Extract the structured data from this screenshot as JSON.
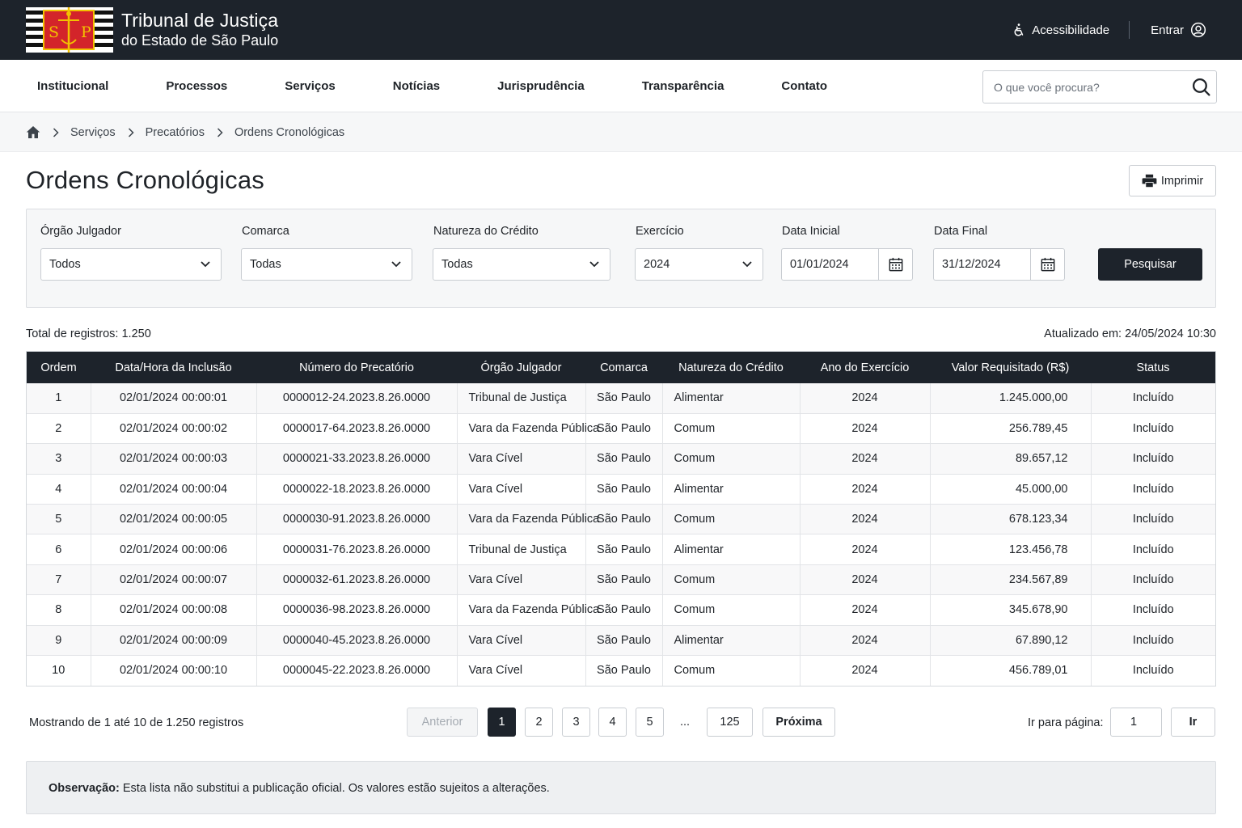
{
  "header": {
    "title": "Tribunal de Justiça",
    "subtitle": "do Estado de São Paulo",
    "logo_letters": "S P",
    "accessibility_label": "Acessibilidade",
    "login_label": "Entrar"
  },
  "nav": {
    "items": [
      {
        "label": "Institucional"
      },
      {
        "label": "Processos"
      },
      {
        "label": "Serviços"
      },
      {
        "label": "Notícias"
      },
      {
        "label": "Jurisprudência"
      },
      {
        "label": "Transparência"
      },
      {
        "label": "Contato"
      }
    ],
    "search_placeholder": "O que você procura?"
  },
  "breadcrumb": {
    "items": [
      {
        "label": "Serviços"
      },
      {
        "label": "Precatórios"
      },
      {
        "label": "Ordens Cronológicas"
      }
    ]
  },
  "page": {
    "title": "Ordens Cronológicas",
    "print_label": "Imprimir"
  },
  "filters": {
    "orgao": {
      "label": "Órgão Julgador",
      "value": "Todos"
    },
    "comarca": {
      "label": "Comarca",
      "value": "Todas"
    },
    "natureza": {
      "label": "Natureza do Crédito",
      "value": "Todas"
    },
    "exercicio": {
      "label": "Exercício",
      "value": "2024"
    },
    "data_inicial": {
      "label": "Data Inicial",
      "value": "01/01/2024"
    },
    "data_final": {
      "label": "Data Final",
      "value": "31/12/2024"
    },
    "submit_label": "Pesquisar"
  },
  "summary": {
    "total": "Total de registros: 1.250",
    "updated": "Atualizado em: 24/05/2024 10:30"
  },
  "table": {
    "columns": [
      "Ordem",
      "Data/Hora da Inclusão",
      "Número do Precatório",
      "Órgão Julgador",
      "Comarca",
      "Natureza do Crédito",
      "Ano do Exercício",
      "Valor Requisitado (R$)",
      "Status"
    ],
    "rows": [
      [
        "1",
        "02/01/2024 00:00:01",
        "0000012-24.2023.8.26.0000",
        "Tribunal de Justiça",
        "São Paulo",
        "Alimentar",
        "2024",
        "1.245.000,00",
        "Incluído"
      ],
      [
        "2",
        "02/01/2024 00:00:02",
        "0000017-64.2023.8.26.0000",
        "Vara da Fazenda Pública",
        "São Paulo",
        "Comum",
        "2024",
        "256.789,45",
        "Incluído"
      ],
      [
        "3",
        "02/01/2024 00:00:03",
        "0000021-33.2023.8.26.0000",
        "Vara Cível",
        "São Paulo",
        "Comum",
        "2024",
        "89.657,12",
        "Incluído"
      ],
      [
        "4",
        "02/01/2024 00:00:04",
        "0000022-18.2023.8.26.0000",
        "Vara Cível",
        "São Paulo",
        "Alimentar",
        "2024",
        "45.000,00",
        "Incluído"
      ],
      [
        "5",
        "02/01/2024 00:00:05",
        "0000030-91.2023.8.26.0000",
        "Vara da Fazenda Pública",
        "São Paulo",
        "Comum",
        "2024",
        "678.123,34",
        "Incluído"
      ],
      [
        "6",
        "02/01/2024 00:00:06",
        "0000031-76.2023.8.26.0000",
        "Tribunal de Justiça",
        "São Paulo",
        "Alimentar",
        "2024",
        "123.456,78",
        "Incluído"
      ],
      [
        "7",
        "02/01/2024 00:00:07",
        "0000032-61.2023.8.26.0000",
        "Vara Cível",
        "São Paulo",
        "Comum",
        "2024",
        "234.567,89",
        "Incluído"
      ],
      [
        "8",
        "02/01/2024 00:00:08",
        "0000036-98.2023.8.26.0000",
        "Vara da Fazenda Pública",
        "São Paulo",
        "Comum",
        "2024",
        "345.678,90",
        "Incluído"
      ],
      [
        "9",
        "02/01/2024 00:00:09",
        "0000040-45.2023.8.26.0000",
        "Vara Cível",
        "São Paulo",
        "Alimentar",
        "2024",
        "67.890,12",
        "Incluído"
      ],
      [
        "10",
        "02/01/2024 00:00:10",
        "0000045-22.2023.8.26.0000",
        "Vara Cível",
        "São Paulo",
        "Comum",
        "2024",
        "456.789,01",
        "Incluído"
      ]
    ]
  },
  "pagination": {
    "showing": "Mostrando de 1 até 10 de 1.250 registros",
    "prev_label": "Anterior",
    "pages": [
      "1",
      "2",
      "3",
      "4",
      "5"
    ],
    "current_page": "1",
    "ellipsis": "...",
    "last_page": "125",
    "next_label": "Próxima",
    "goto_label": "Ir para página:",
    "goto_value": "1",
    "goto_button": "Ir"
  },
  "note": {
    "label": "Observação:",
    "text": " Esta lista não substitui a publicação oficial. Os valores estão sujeitos a alterações."
  },
  "colors": {
    "header_bg": "#1d232b",
    "flag_red": "#d3242a",
    "flag_gold": "#f2c200",
    "table_header_bg": "#1d232b"
  },
  "icons": [
    "home-icon",
    "chevron-right-icon",
    "search-icon",
    "accessibility-icon",
    "user-icon",
    "printer-icon",
    "chevron-down-icon",
    "calendar-icon"
  ]
}
